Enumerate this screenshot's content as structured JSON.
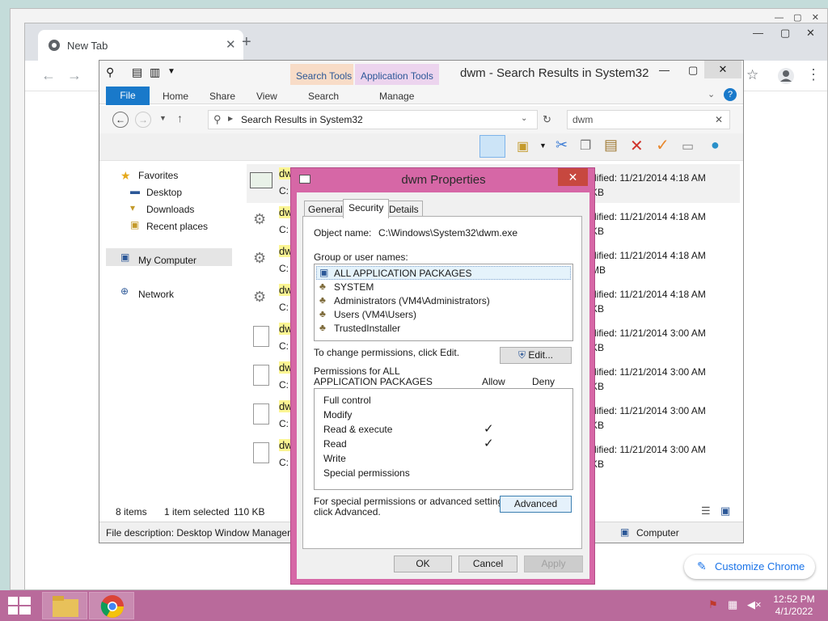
{
  "chrome": {
    "tab_title": "New Tab",
    "customize_label": "Customize Chrome"
  },
  "explorer": {
    "window_title": "dwm - Search Results in System32",
    "context_tabs": {
      "search_tools": "Search Tools",
      "application_tools": "Application Tools"
    },
    "ribbon_tabs": [
      "File",
      "Home",
      "Share",
      "View",
      "Search",
      "Manage"
    ],
    "address": "Search Results in System32",
    "search_value": "dwm",
    "nav": {
      "favorites": "Favorites",
      "desktop": "Desktop",
      "downloads": "Downloads",
      "recent": "Recent places",
      "my_computer": "My Computer",
      "network": "Network"
    },
    "files": [
      {
        "name": "dw",
        "path": "C:",
        "date": "dified: 11/21/2014 4:18 AM",
        "size": "KB"
      },
      {
        "name": "dw",
        "path": "C:",
        "date": "dified: 11/21/2014 4:18 AM",
        "size": "KB"
      },
      {
        "name": "dw",
        "path": "C:",
        "date": "dified: 11/21/2014 4:18 AM",
        "size": "MB"
      },
      {
        "name": "dw",
        "path": "C:",
        "date": "dified: 11/21/2014 4:18 AM",
        "size": "KB"
      },
      {
        "name": "dw",
        "path": "C:",
        "date": "dified: 11/21/2014 3:00 AM",
        "size": "KB"
      },
      {
        "name": "dw",
        "path": "C:",
        "date": "dified: 11/21/2014 3:00 AM",
        "size": "KB"
      },
      {
        "name": "dw",
        "path": "C:",
        "date": "dified: 11/21/2014 3:00 AM",
        "size": "KB"
      },
      {
        "name": "dw",
        "path": "C:",
        "date": "dified: 11/21/2014 3:00 AM",
        "size": "KB"
      }
    ],
    "status": {
      "count": "8 items",
      "selected": "1 item selected",
      "size": "110 KB"
    },
    "description": "File description: Desktop Window Manager",
    "computer_label": "Computer"
  },
  "dialog": {
    "title": "dwm Properties",
    "tabs": [
      "General",
      "Security",
      "Details"
    ],
    "object_name_label": "Object name:",
    "object_name_value": "C:\\Windows\\System32\\dwm.exe",
    "group_label": "Group or user names:",
    "groups": [
      "ALL APPLICATION PACKAGES",
      "SYSTEM",
      "Administrators (VM4\\Administrators)",
      "Users (VM4\\Users)",
      "TrustedInstaller"
    ],
    "change_text": "To change permissions, click Edit.",
    "edit_label": "Edit...",
    "perm_for_line1": "Permissions for ALL",
    "perm_for_line2": "APPLICATION PACKAGES",
    "allow_label": "Allow",
    "deny_label": "Deny",
    "permissions": [
      {
        "name": "Full control",
        "allow": ""
      },
      {
        "name": "Modify",
        "allow": ""
      },
      {
        "name": "Read & execute",
        "allow": "✓"
      },
      {
        "name": "Read",
        "allow": "✓"
      },
      {
        "name": "Write",
        "allow": ""
      },
      {
        "name": "Special permissions",
        "allow": ""
      }
    ],
    "special_line1": "For special permissions or advanced settings,",
    "special_line2": "click Advanced.",
    "advanced_label": "Advanced",
    "ok_label": "OK",
    "cancel_label": "Cancel",
    "apply_label": "Apply"
  },
  "taskbar": {
    "time": "12:52 PM",
    "date": "4/1/2022"
  },
  "colors": {
    "dialog_frame": "#d667a6",
    "taskbar": "#b96a9b",
    "file_tab": "#1979ca"
  }
}
